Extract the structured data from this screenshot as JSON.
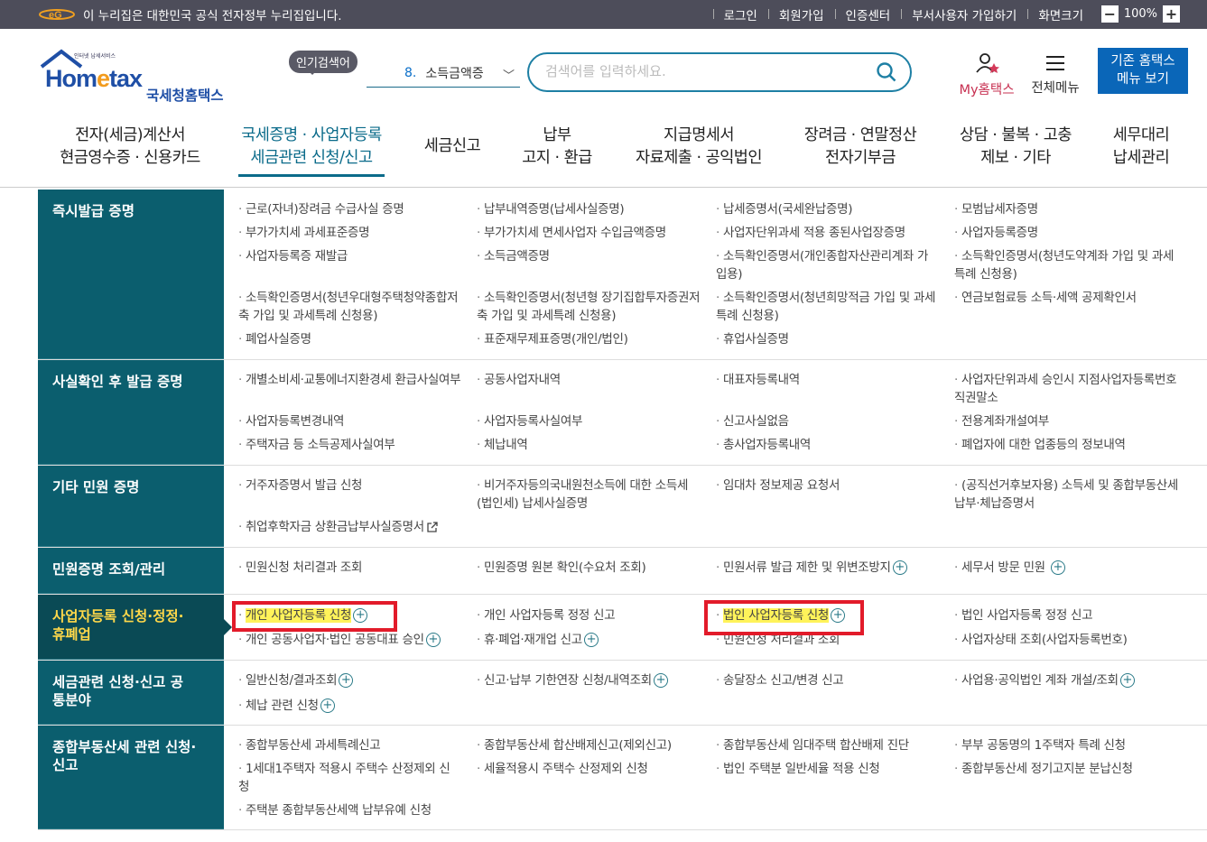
{
  "topbar": {
    "gov_text": "이 누리집은 대한민국 공식 전자정부 누리집입니다.",
    "links": [
      "로그인",
      "회원가입",
      "인증센터",
      "부서사용자 가입하기",
      "화면크기"
    ],
    "zoom": "100%",
    "zoom_minus": "−",
    "zoom_plus": "+"
  },
  "header": {
    "logo_small": "인터넷 납세서비스",
    "logo_home": "Hom",
    "logo_e": "e",
    "logo_tax": "tax",
    "logo_kor": "국세청홈택스",
    "popular_label": "인기검색어",
    "rank_num": "8.",
    "rank_term": "소득금액증",
    "rank_chevron": "﹀",
    "search_placeholder": "검색어를 입력하세요.",
    "my_hometax": "My홈택스",
    "all_menu": "전체메뉴",
    "old_hometax": "기존 홈택스",
    "old_hometax2": "메뉴 보기"
  },
  "gnb": [
    [
      "전자(세금)계산서",
      "현금영수증 · 신용카드"
    ],
    [
      "국세증명 · 사업자등록",
      "세금관련 신청/신고"
    ],
    [
      "세금신고",
      ""
    ],
    [
      "납부",
      "고지 · 환급"
    ],
    [
      "지급명세서",
      "자료제출 · 공익법인"
    ],
    [
      "장려금 · 연말정산",
      "전자기부금"
    ],
    [
      "상담 · 불복 · 고충",
      "제보 · 기타"
    ],
    [
      "세무대리",
      "납세관리"
    ]
  ],
  "sections": [
    {
      "title": "즉시발급 증명",
      "items": [
        [
          "근로(자녀)장려금 수급사실 증명",
          "납부내역증명(납세사실증명)",
          "납세증명서(국세완납증명)",
          "모범납세자증명"
        ],
        [
          "부가가치세 과세표준증명",
          "부가가치세 면세사업자 수입금액증명",
          "사업자단위과세 적용 종된사업장증명",
          "사업자등록증명"
        ],
        [
          "사업자등록증 재발급",
          "소득금액증명",
          "소득확인증명서(개인종합자산관리계좌 가입용)",
          "소득확인증명서(청년도약계좌 가입 및 과세특례 신청용)"
        ],
        [
          "소득확인증명서(청년우대형주택청약종합저축 가입 및 과세특례 신청용)",
          "소득확인증명서(청년형 장기집합투자증권저축 가입 및 과세특례 신청용)",
          "소득확인증명서(청년희망적금 가입 및 과세특례 신청용)",
          "연금보험료등 소득·세액 공제확인서"
        ],
        [
          "폐업사실증명",
          "표준재무제표증명(개인/법인)",
          "휴업사실증명",
          ""
        ]
      ]
    },
    {
      "title": "사실확인 후 발급 증명",
      "items": [
        [
          "개별소비세·교통에너지환경세 환급사실여부",
          "공동사업자내역",
          "대표자등록내역",
          "사업자단위과세 승인시 지점사업자등록번호 직권말소"
        ],
        [
          "사업자등록변경내역",
          "사업자등록사실여부",
          "신고사실없음",
          "전용계좌개설여부"
        ],
        [
          "주택자금 등 소득공제사실여부",
          "체납내역",
          "총사업자등록내역",
          "폐업자에 대한 업종등의 정보내역"
        ]
      ]
    },
    {
      "title": "기타 민원 증명",
      "items": [
        [
          "거주자증명서 발급 신청",
          "비거주자등의국내원천소득에 대한 소득세(법인세) 납세사실증명",
          "임대차 정보제공 요청서",
          "(공직선거후보자용) 소득세 및 종합부동산세 납부·체납증명서"
        ],
        [
          "취업후학자금 상환금납부사실증명서",
          "",
          "",
          ""
        ]
      ]
    },
    {
      "title": "민원증명 조회/관리",
      "items": [
        [
          "민원신청 처리결과 조회",
          "민원증명 원본 확인(수요처 조회)",
          "민원서류 발급 제한 및 위변조방지",
          "세무서 방문 민원"
        ]
      ]
    },
    {
      "title": "사업자등록 신청·정정·휴폐업",
      "items": [
        [
          "개인 사업자등록 신청",
          "개인 사업자등록 정정 신고",
          "법인 사업자등록 신청",
          "법인 사업자등록 정정 신고"
        ],
        [
          "개인 공동사업자·법인 공동대표 승인",
          "휴·폐업·재개업 신고",
          "민원신청 처리결과 조회",
          "사업자상태 조회(사업자등록번호)"
        ]
      ]
    },
    {
      "title": "세금관련 신청·신고 공통분야",
      "items": [
        [
          "일반신청/결과조회",
          "신고·납부 기한연장 신청/내역조회",
          "송달장소 신고/변경 신고",
          "사업용·공익법인 계좌 개설/조회"
        ],
        [
          "체납 관련 신청",
          "",
          "",
          ""
        ]
      ]
    },
    {
      "title": "종합부동산세 관련 신청·신고",
      "items": [
        [
          "종합부동산세 과세특례신고",
          "종합부동산세 합산배제신고(제외신고)",
          "종합부동산세 임대주택 합산배제 진단",
          "부부 공동명의 1주택자 특례 신청"
        ],
        [
          "1세대1주택자 적용시 주택수 산정제외 신청",
          "세율적용시 주택수 산정제외 신청",
          "법인 주택분 일반세율 적용 신청",
          "종합부동산세 정기고지분 분납신청"
        ],
        [
          "주택분 종합부동산세액 납부유예 신청",
          "",
          "",
          ""
        ]
      ]
    }
  ],
  "colors": {
    "teal": "#0b5e6e",
    "selected_cat": "#0a4a55",
    "selected_text": "#ffd84a",
    "highlight": "#fff35a",
    "red_box": "#e21b2a",
    "accent_blue": "#0a66b8"
  }
}
